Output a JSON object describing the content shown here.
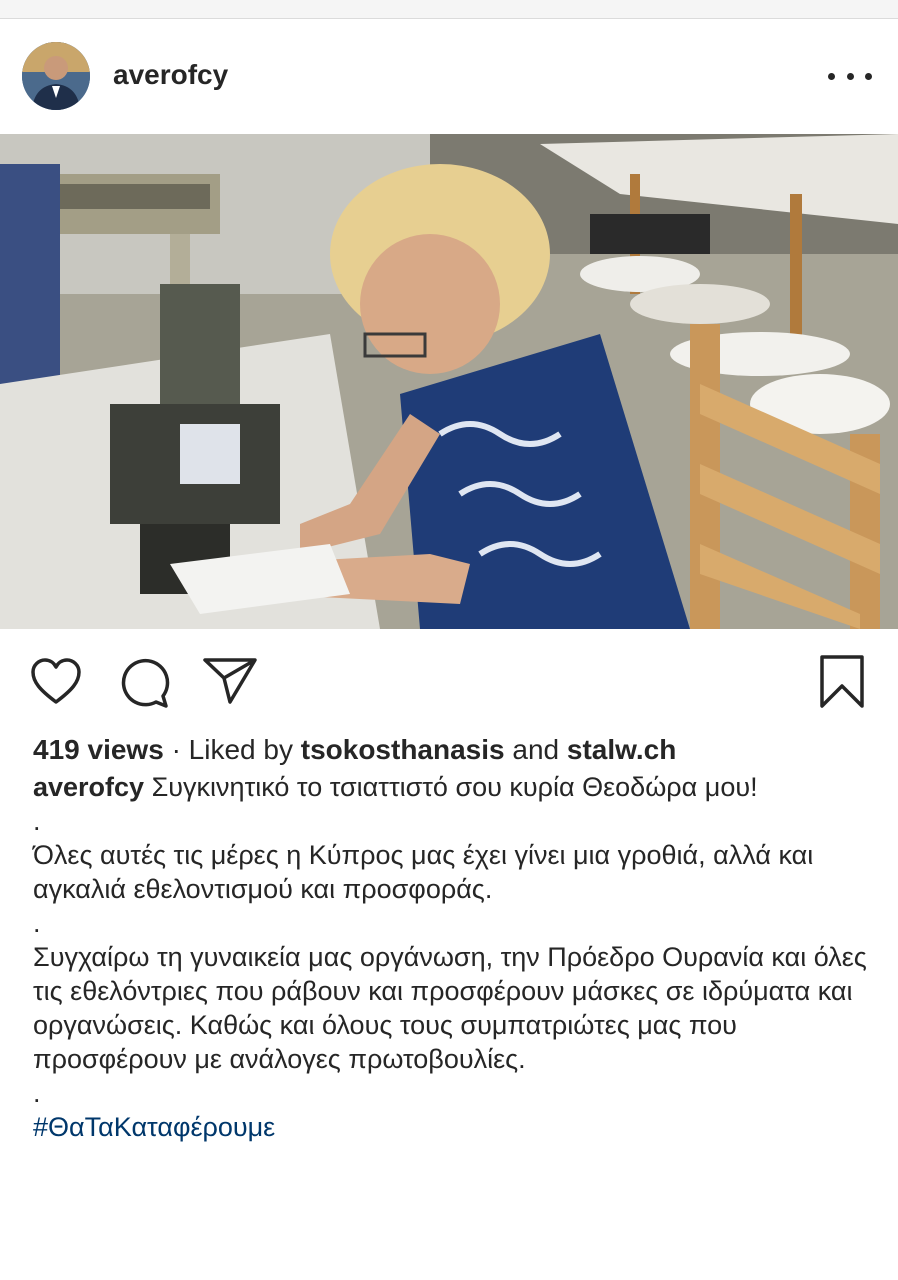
{
  "post": {
    "username": "averofcy",
    "more_label": "More options",
    "photo_alt": "Woman sewing at a sewing machine in a workshop"
  },
  "stats": {
    "views": "419 views",
    "separator": "·",
    "liked_by_prefix": "Liked by",
    "liker_1": "tsokosthanasis",
    "and": "and",
    "liker_2": "stalw.ch"
  },
  "caption": {
    "username": "averofcy",
    "paragraph_1": "Συγκινητικό το τσιαττιστό σου κυρία Θεοδώρα μου!",
    "dot_1": ".",
    "paragraph_2": "Όλες αυτές τις μέρες η Κύπρος μας έχει γίνει μια γροθιά, αλλά και αγκαλιά εθελοντισμού και προσφοράς.",
    "dot_2": ".",
    "paragraph_3": "Συγχαίρω τη γυναικεία μας οργάνωση, την Πρόεδρο Ουρανία και όλες τις εθελόντριες που ράβουν και προσφέρουν μάσκες σε ιδρύματα και οργανώσεις. Καθώς και όλους τους συμπατριώτες μας που προσφέρουν με ανάλογες πρωτοβουλίες.",
    "dot_3": ".",
    "hashtag": "#ΘαΤαΚαταφέρουμε"
  },
  "icons": {
    "like": "heart-icon",
    "comment": "comment-icon",
    "share": "paper-plane-icon",
    "save": "bookmark-icon",
    "more": "ellipsis-icon"
  },
  "colors": {
    "text": "#262626",
    "hashtag": "#00376b",
    "divider": "#dbdbdb"
  }
}
